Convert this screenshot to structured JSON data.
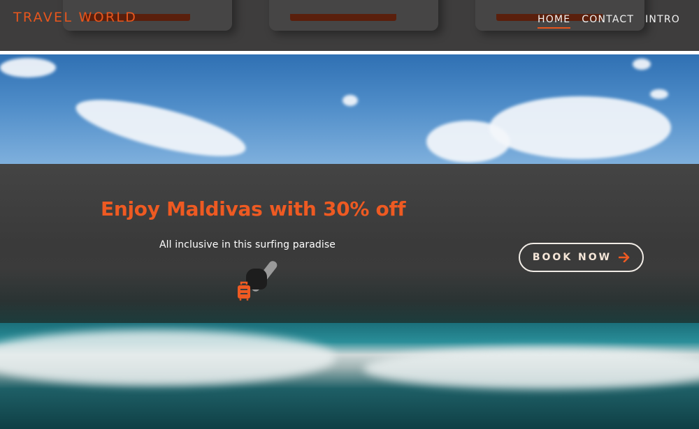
{
  "header": {
    "brand": "TRAVEL WORLD",
    "nav": [
      {
        "label": "HOME",
        "active": true
      },
      {
        "label": "CONTACT",
        "active": false
      },
      {
        "label": "INTRO",
        "active": false
      }
    ]
  },
  "promo": {
    "title": "Enjoy Maldivas with 30% off",
    "subtitle": "All inclusive in this surfing paradise",
    "button_label": "BOOK NOW",
    "button_icon": "arrow-right-icon",
    "feature_icon": "luggage-icon"
  },
  "colors": {
    "accent": "#ee5a22",
    "header_bg": "#3e3d3d",
    "band_bg": "#3d3d3d",
    "button_border": "#f1ece6"
  }
}
